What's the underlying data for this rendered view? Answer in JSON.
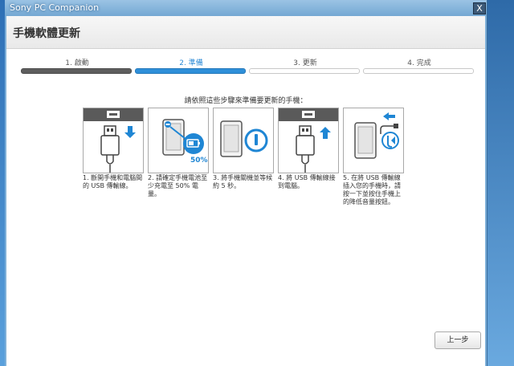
{
  "window": {
    "title": "Sony PC Companion",
    "close_label": "X"
  },
  "header": {
    "title": "手機軟體更新"
  },
  "steps": [
    {
      "label": "1. 啟動",
      "state": "done"
    },
    {
      "label": "2. 準備",
      "state": "active"
    },
    {
      "label": "3. 更新",
      "state": "pending"
    },
    {
      "label": "4. 完成",
      "state": "pending"
    }
  ],
  "instruction": "請依照這些步驟來準備要更新的手機：",
  "cards": [
    {
      "icon": "usb-unplug-icon",
      "caption": "1. 斷開手機和電腦間的 USB 傳輸線。"
    },
    {
      "icon": "battery-icon",
      "badge": "50%",
      "caption": "2. 請確定手機電池至少充電至 50% 電量。"
    },
    {
      "icon": "power-icon",
      "caption": "3. 將手機關機並等候約 5 秒。"
    },
    {
      "icon": "usb-plug-icon",
      "caption": "4. 將 USB 傳輸線接到電腦。"
    },
    {
      "icon": "volume-down-icon",
      "caption": "5. 在將 USB 傳輸線插入您的手機時，請按一下並按住手機上的降低音量按鈕。"
    }
  ],
  "footer": {
    "back_label": "上一步"
  },
  "colors": {
    "accent": "#2f8fd9",
    "dark_bar": "#5e5e5e"
  }
}
